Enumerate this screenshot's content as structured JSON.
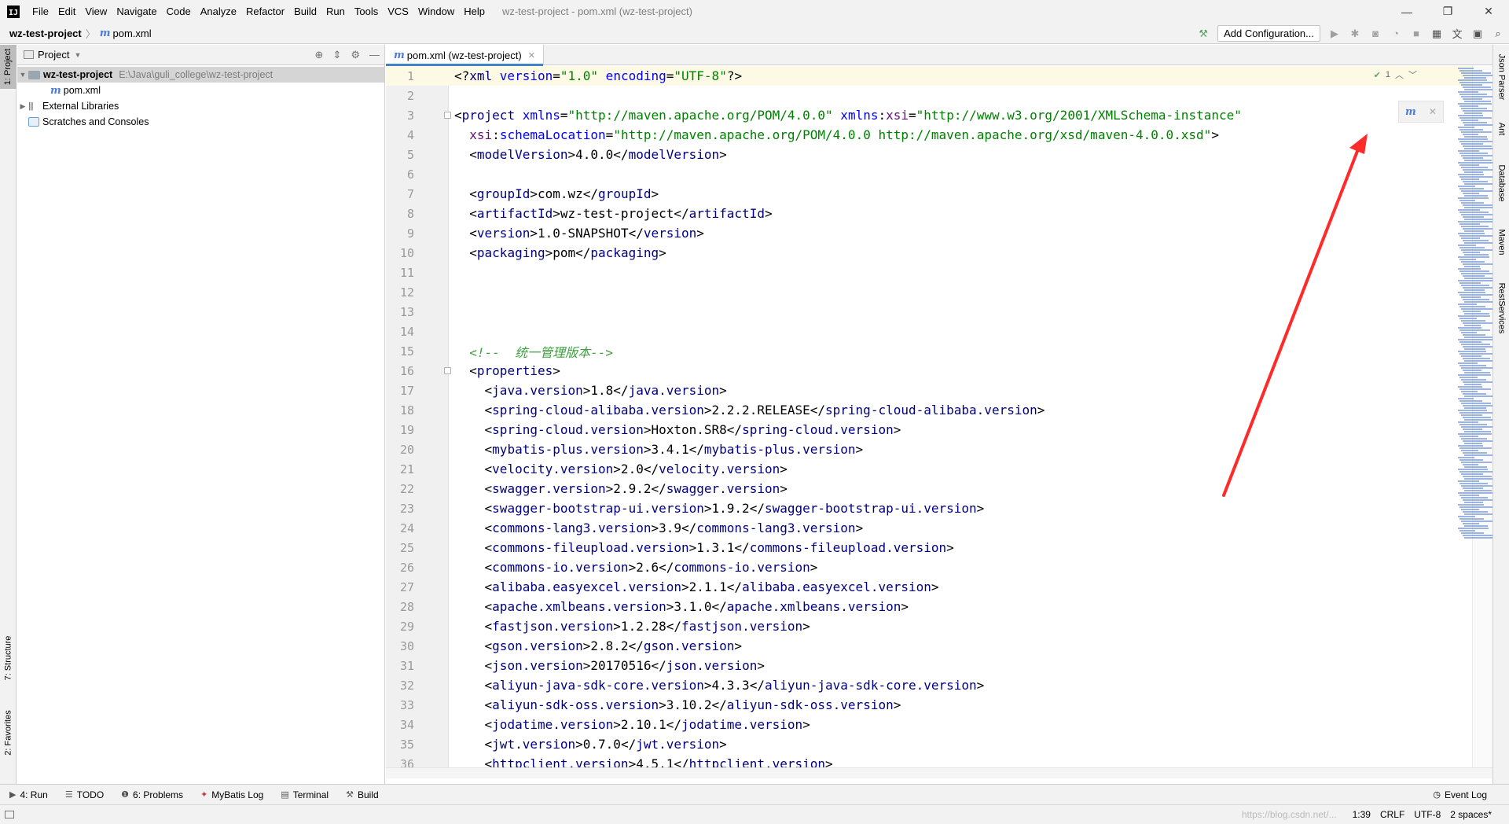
{
  "app": {
    "logo_text": "IJ",
    "window_title": "wz-test-project - pom.xml (wz-test-project)",
    "menu": [
      "File",
      "Edit",
      "View",
      "Navigate",
      "Code",
      "Analyze",
      "Refactor",
      "Build",
      "Run",
      "Tools",
      "VCS",
      "Window",
      "Help"
    ],
    "window_controls": [
      "—",
      "❐",
      "✕"
    ]
  },
  "breadcrumb": {
    "project": "wz-test-project",
    "file": "pom.xml"
  },
  "toolbar": {
    "add_configuration": "Add Configuration..."
  },
  "left_stripe": {
    "project": "1: Project",
    "structure": "7: Structure",
    "favorites": "2: Favorites"
  },
  "right_stripe": [
    "Json Parser",
    "Ant",
    "Database",
    "Maven",
    "RestServices"
  ],
  "project_panel": {
    "title": "Project",
    "tree": {
      "root_name": "wz-test-project",
      "root_path": "E:\\Java\\guli_college\\wz-test-project",
      "pom": "pom.xml",
      "external": "External Libraries",
      "scratches": "Scratches and Consoles"
    }
  },
  "editor": {
    "tab_label": "pom.xml (wz-test-project)",
    "inspection_count": "1",
    "current_line": 1
  },
  "code_lines": [
    {
      "n": "1",
      "p": [
        [
          "plain",
          "<?"
        ],
        [
          "tag",
          "xml "
        ],
        [
          "attr",
          "version"
        ],
        [
          "plain",
          "="
        ],
        [
          "val",
          "\"1.0\""
        ],
        [
          "attr",
          " encoding"
        ],
        [
          "plain",
          "="
        ],
        [
          "val",
          "\"UTF-8\""
        ],
        [
          "plain",
          "?>"
        ]
      ]
    },
    {
      "n": "2",
      "p": []
    },
    {
      "n": "3",
      "fold": true,
      "p": [
        [
          "plain",
          "<"
        ],
        [
          "tag",
          "project "
        ],
        [
          "attr",
          "xmlns"
        ],
        [
          "plain",
          "="
        ],
        [
          "val",
          "\"http://maven.apache.org/POM/4.0.0\""
        ],
        [
          "attr",
          " xmlns"
        ],
        [
          "plain",
          ":"
        ],
        [
          "ns",
          "xsi"
        ],
        [
          "plain",
          "="
        ],
        [
          "val",
          "\"http://www.w3.org/2001/XMLSchema-instance\""
        ]
      ]
    },
    {
      "n": "4",
      "p": [
        [
          "plain",
          "  "
        ],
        [
          "ns",
          "xsi"
        ],
        [
          "plain",
          ":"
        ],
        [
          "attr",
          "schemaLocation"
        ],
        [
          "plain",
          "="
        ],
        [
          "val",
          "\"http://maven.apache.org/POM/4.0.0 http://maven.apache.org/xsd/maven-4.0.0.xsd\""
        ],
        [
          "plain",
          ">"
        ]
      ]
    },
    {
      "n": "5",
      "p": [
        [
          "plain",
          "  <"
        ],
        [
          "tag",
          "modelVersion"
        ],
        [
          "plain",
          ">4.0.0</"
        ],
        [
          "tag",
          "modelVersion"
        ],
        [
          "plain",
          ">"
        ]
      ]
    },
    {
      "n": "6",
      "p": []
    },
    {
      "n": "7",
      "p": [
        [
          "plain",
          "  <"
        ],
        [
          "tag",
          "groupId"
        ],
        [
          "plain",
          ">com.wz</"
        ],
        [
          "tag",
          "groupId"
        ],
        [
          "plain",
          ">"
        ]
      ]
    },
    {
      "n": "8",
      "p": [
        [
          "plain",
          "  <"
        ],
        [
          "tag",
          "artifactId"
        ],
        [
          "plain",
          ">wz-test-project</"
        ],
        [
          "tag",
          "artifactId"
        ],
        [
          "plain",
          ">"
        ]
      ]
    },
    {
      "n": "9",
      "p": [
        [
          "plain",
          "  <"
        ],
        [
          "tag",
          "version"
        ],
        [
          "plain",
          ">1.0-SNAPSHOT</"
        ],
        [
          "tag",
          "version"
        ],
        [
          "plain",
          ">"
        ]
      ]
    },
    {
      "n": "10",
      "p": [
        [
          "plain",
          "  <"
        ],
        [
          "tag",
          "packaging"
        ],
        [
          "plain",
          ">pom</"
        ],
        [
          "tag",
          "packaging"
        ],
        [
          "plain",
          ">"
        ]
      ]
    },
    {
      "n": "11",
      "p": []
    },
    {
      "n": "12",
      "p": []
    },
    {
      "n": "13",
      "p": []
    },
    {
      "n": "14",
      "p": []
    },
    {
      "n": "15",
      "p": [
        [
          "plain",
          "  "
        ],
        [
          "cmt-green",
          "<!--  统一管理版本-->"
        ]
      ]
    },
    {
      "n": "16",
      "fold": true,
      "p": [
        [
          "plain",
          "  <"
        ],
        [
          "tag",
          "properties"
        ],
        [
          "plain",
          ">"
        ]
      ]
    },
    {
      "n": "17",
      "p": [
        [
          "plain",
          "    <"
        ],
        [
          "tag",
          "java.version"
        ],
        [
          "plain",
          ">1.8</"
        ],
        [
          "tag",
          "java.version"
        ],
        [
          "plain",
          ">"
        ]
      ]
    },
    {
      "n": "18",
      "p": [
        [
          "plain",
          "    <"
        ],
        [
          "tag",
          "spring-cloud-alibaba.version"
        ],
        [
          "plain",
          ">2.2.2.RELEASE</"
        ],
        [
          "tag",
          "spring-cloud-alibaba.version"
        ],
        [
          "plain",
          ">"
        ]
      ]
    },
    {
      "n": "19",
      "p": [
        [
          "plain",
          "    <"
        ],
        [
          "tag",
          "spring-cloud.version"
        ],
        [
          "plain",
          ">Hoxton.SR8</"
        ],
        [
          "tag",
          "spring-cloud.version"
        ],
        [
          "plain",
          ">"
        ]
      ]
    },
    {
      "n": "20",
      "p": [
        [
          "plain",
          "    <"
        ],
        [
          "tag",
          "mybatis-plus.version"
        ],
        [
          "plain",
          ">3.4.1</"
        ],
        [
          "tag",
          "mybatis-plus.version"
        ],
        [
          "plain",
          ">"
        ]
      ]
    },
    {
      "n": "21",
      "p": [
        [
          "plain",
          "    <"
        ],
        [
          "tag",
          "velocity.version"
        ],
        [
          "plain",
          ">2.0</"
        ],
        [
          "tag",
          "velocity.version"
        ],
        [
          "plain",
          ">"
        ]
      ]
    },
    {
      "n": "22",
      "p": [
        [
          "plain",
          "    <"
        ],
        [
          "tag",
          "swagger.version"
        ],
        [
          "plain",
          ">2.9.2</"
        ],
        [
          "tag",
          "swagger.version"
        ],
        [
          "plain",
          ">"
        ]
      ]
    },
    {
      "n": "23",
      "p": [
        [
          "plain",
          "    <"
        ],
        [
          "tag",
          "swagger-bootstrap-ui.version"
        ],
        [
          "plain",
          ">1.9.2</"
        ],
        [
          "tag",
          "swagger-bootstrap-ui.version"
        ],
        [
          "plain",
          ">"
        ]
      ]
    },
    {
      "n": "24",
      "p": [
        [
          "plain",
          "    <"
        ],
        [
          "tag",
          "commons-lang3.version"
        ],
        [
          "plain",
          ">3.9</"
        ],
        [
          "tag",
          "commons-lang3.version"
        ],
        [
          "plain",
          ">"
        ]
      ]
    },
    {
      "n": "25",
      "p": [
        [
          "plain",
          "    <"
        ],
        [
          "tag",
          "commons-fileupload.version"
        ],
        [
          "plain",
          ">1.3.1</"
        ],
        [
          "tag",
          "commons-fileupload.version"
        ],
        [
          "plain",
          ">"
        ]
      ]
    },
    {
      "n": "26",
      "p": [
        [
          "plain",
          "    <"
        ],
        [
          "tag",
          "commons-io.version"
        ],
        [
          "plain",
          ">2.6</"
        ],
        [
          "tag",
          "commons-io.version"
        ],
        [
          "plain",
          ">"
        ]
      ]
    },
    {
      "n": "27",
      "p": [
        [
          "plain",
          "    <"
        ],
        [
          "tag",
          "alibaba.easyexcel.version"
        ],
        [
          "plain",
          ">2.1.1</"
        ],
        [
          "tag",
          "alibaba.easyexcel.version"
        ],
        [
          "plain",
          ">"
        ]
      ]
    },
    {
      "n": "28",
      "p": [
        [
          "plain",
          "    <"
        ],
        [
          "tag",
          "apache.xmlbeans.version"
        ],
        [
          "plain",
          ">3.1.0</"
        ],
        [
          "tag",
          "apache.xmlbeans.version"
        ],
        [
          "plain",
          ">"
        ]
      ]
    },
    {
      "n": "29",
      "p": [
        [
          "plain",
          "    <"
        ],
        [
          "tag",
          "fastjson.version"
        ],
        [
          "plain",
          ">1.2.28</"
        ],
        [
          "tag",
          "fastjson.version"
        ],
        [
          "plain",
          ">"
        ]
      ]
    },
    {
      "n": "30",
      "p": [
        [
          "plain",
          "    <"
        ],
        [
          "tag",
          "gson.version"
        ],
        [
          "plain",
          ">2.8.2</"
        ],
        [
          "tag",
          "gson.version"
        ],
        [
          "plain",
          ">"
        ]
      ]
    },
    {
      "n": "31",
      "p": [
        [
          "plain",
          "    <"
        ],
        [
          "tag",
          "json.version"
        ],
        [
          "plain",
          ">20170516</"
        ],
        [
          "tag",
          "json.version"
        ],
        [
          "plain",
          ">"
        ]
      ]
    },
    {
      "n": "32",
      "p": [
        [
          "plain",
          "    <"
        ],
        [
          "tag",
          "aliyun-java-sdk-core.version"
        ],
        [
          "plain",
          ">4.3.3</"
        ],
        [
          "tag",
          "aliyun-java-sdk-core.version"
        ],
        [
          "plain",
          ">"
        ]
      ]
    },
    {
      "n": "33",
      "p": [
        [
          "plain",
          "    <"
        ],
        [
          "tag",
          "aliyun-sdk-oss.version"
        ],
        [
          "plain",
          ">3.10.2</"
        ],
        [
          "tag",
          "aliyun-sdk-oss.version"
        ],
        [
          "plain",
          ">"
        ]
      ]
    },
    {
      "n": "34",
      "p": [
        [
          "plain",
          "    <"
        ],
        [
          "tag",
          "jodatime.version"
        ],
        [
          "plain",
          ">2.10.1</"
        ],
        [
          "tag",
          "jodatime.version"
        ],
        [
          "plain",
          ">"
        ]
      ]
    },
    {
      "n": "35",
      "p": [
        [
          "plain",
          "    <"
        ],
        [
          "tag",
          "jwt.version"
        ],
        [
          "plain",
          ">0.7.0</"
        ],
        [
          "tag",
          "jwt.version"
        ],
        [
          "plain",
          ">"
        ]
      ]
    },
    {
      "n": "36",
      "p": [
        [
          "plain",
          "    <"
        ],
        [
          "tag",
          "httpclient.version"
        ],
        [
          "plain",
          ">4.5.1</"
        ],
        [
          "tag",
          "httpclient.version"
        ],
        [
          "plain",
          ">"
        ]
      ]
    }
  ],
  "tool_windows": [
    {
      "label": "4: Run",
      "icon": "run-icon"
    },
    {
      "label": "TODO",
      "icon": "todo-icon"
    },
    {
      "label": "6: Problems",
      "icon": "problems-icon"
    },
    {
      "label": "MyBatis Log",
      "icon": "mybatis-icon"
    },
    {
      "label": "Terminal",
      "icon": "terminal-icon"
    },
    {
      "label": "Build",
      "icon": "build-icon"
    }
  ],
  "event_log": "Event Log",
  "status": {
    "position": "1:39",
    "line_sep": "CRLF",
    "encoding": "UTF-8",
    "indent": "2 spaces*",
    "watermark": "https://blog.csdn.net/..."
  },
  "colors": {
    "annotation_arrow": "#ff2a2a",
    "tab_underline": "#4083c9",
    "xml_tag": "#000080",
    "xml_attr": "#0000ff",
    "xml_value": "#008000"
  }
}
